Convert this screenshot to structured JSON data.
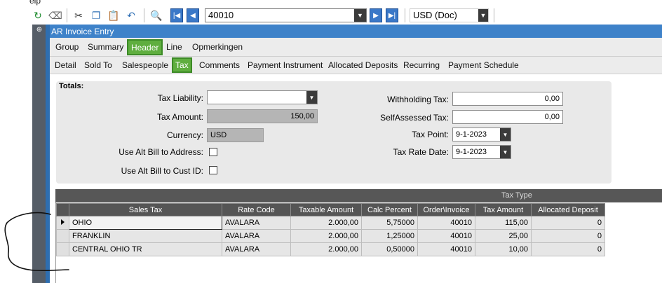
{
  "menu_fragment": "elp",
  "toolbar": {
    "record_id": "40010",
    "currency": "USD (Doc)"
  },
  "window": {
    "title": "AR Invoice Entry"
  },
  "tabs_primary": [
    {
      "label": "Group",
      "active": false
    },
    {
      "label": "Summary",
      "active": false
    },
    {
      "label": "Header",
      "active": true
    },
    {
      "label": "Line",
      "active": false
    },
    {
      "label": "Opmerkingen",
      "active": false
    }
  ],
  "tabs_secondary": [
    {
      "label": "Detail",
      "active": false
    },
    {
      "label": "Sold To",
      "active": false
    },
    {
      "label": "Salespeople",
      "active": false
    },
    {
      "label": "Tax",
      "active": true
    },
    {
      "label": "Comments",
      "active": false
    },
    {
      "label": "Payment Instrument",
      "active": false
    },
    {
      "label": "Allocated Deposits",
      "active": false
    },
    {
      "label": "Recurring",
      "active": false
    },
    {
      "label": "Payment Schedule",
      "active": false
    }
  ],
  "totals": {
    "heading": "Totals:",
    "tax_liability_label": "Tax Liability:",
    "tax_liability_value": "",
    "tax_amount_label": "Tax Amount:",
    "tax_amount_value": "150,00",
    "currency_label": "Currency:",
    "currency_value": "USD",
    "alt_bill_address_label": "Use Alt Bill to Address:",
    "alt_bill_cust_label": "Use Alt Bill to Cust ID:",
    "withholding_label": "Withholding Tax:",
    "withholding_value": "0,00",
    "selfassessed_label": "SelfAssessed Tax:",
    "selfassessed_value": "0,00",
    "tax_point_label": "Tax Point:",
    "tax_point_value": "9-1-2023",
    "tax_rate_date_label": "Tax Rate Date:",
    "tax_rate_date_value": "9-1-2023"
  },
  "grid": {
    "group_header": "Tax Type",
    "columns": [
      "Sales Tax",
      "Rate Code",
      "Taxable Amount",
      "Calc Percent",
      "Order\\Invoice",
      "Tax Amount",
      "Allocated Deposit"
    ],
    "rows": [
      [
        "OHIO",
        "AVALARA",
        "2.000,00",
        "5,75000",
        "40010",
        "115,00",
        "0"
      ],
      [
        "FRANKLIN",
        "AVALARA",
        "2.000,00",
        "1,25000",
        "40010",
        "25,00",
        "0"
      ],
      [
        "CENTRAL OHIO TR",
        "AVALARA",
        "2.000,00",
        "0,50000",
        "40010",
        "10,00",
        "0"
      ]
    ]
  }
}
